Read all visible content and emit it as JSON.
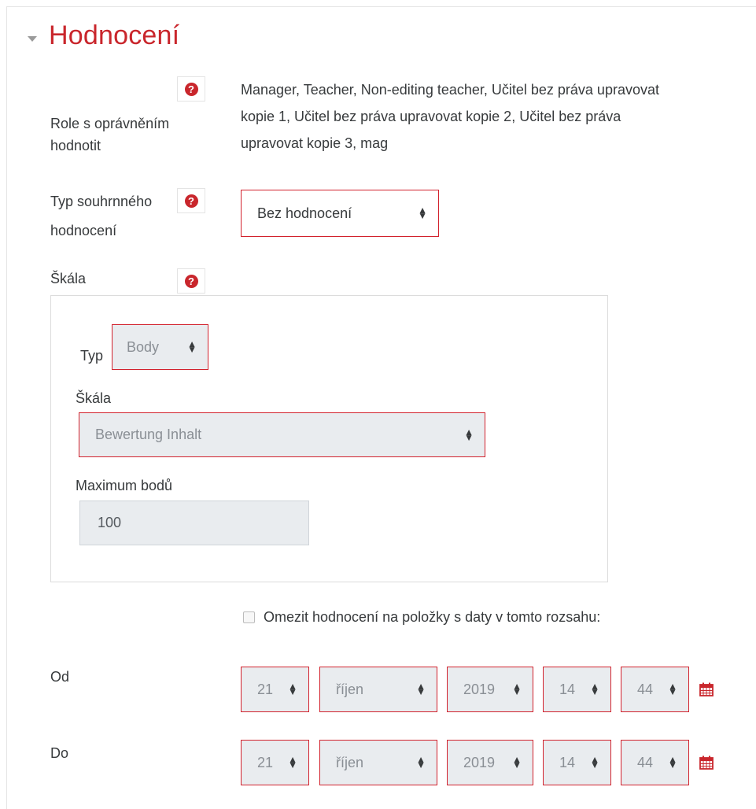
{
  "section": {
    "title": "Hodnocení"
  },
  "grading_roles": {
    "label": "Role s oprávněním hodnotit",
    "value_lines": [
      "Manager, Teacher, Non-editing teacher, Učitel bez práva upravovat",
      "kopie 1, Učitel bez práva upravovat kopie 2, Učitel bez práva",
      "upravovat kopie 3, mag"
    ]
  },
  "aggregate": {
    "label_line1": "Typ souhrnného",
    "label_line2": "hodnocení",
    "selected": "Bez hodnocení"
  },
  "scale": {
    "label": "Škála",
    "type_label": "Typ",
    "type_selected": "Body",
    "scale_label": "Škála",
    "scale_selected": "Bewertung Inhalt",
    "max_label": "Maximum bodů",
    "max_value": "100"
  },
  "restrict": {
    "checkbox_label": "Omezit hodnocení na položky s daty v tomto rozsahu:",
    "checked": false
  },
  "from": {
    "label": "Od",
    "day": "21",
    "month": "říjen",
    "year": "2019",
    "hour": "14",
    "minute": "44"
  },
  "to": {
    "label": "Do",
    "day": "21",
    "month": "říjen",
    "year": "2019",
    "hour": "14",
    "minute": "44"
  },
  "colors": {
    "accent": "#c9262c",
    "error_border": "#d2222d",
    "disabled_bg": "#e9ecef"
  },
  "icons": {
    "collapse": "triangle-down-icon",
    "help": "question-circle-icon",
    "calendar": "calendar-icon"
  }
}
